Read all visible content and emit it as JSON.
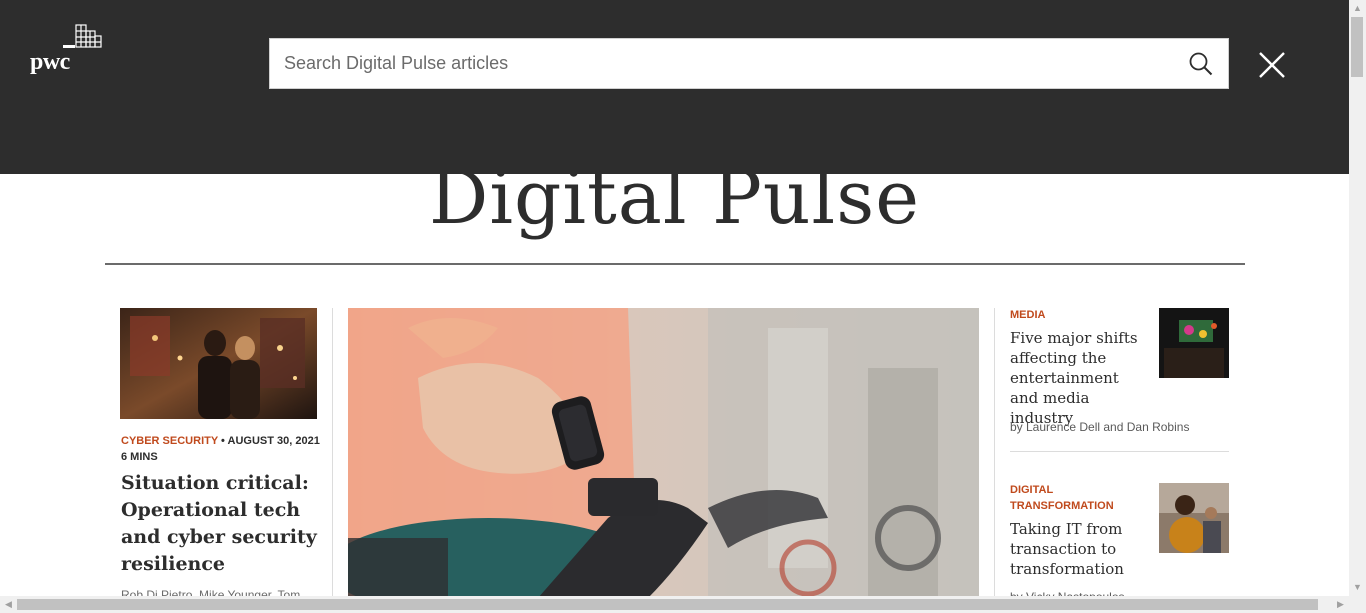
{
  "header": {
    "logo_text": "pwc",
    "search_placeholder": "Search Digital Pulse articles"
  },
  "page": {
    "title": "Digital Pulse"
  },
  "featured_left": {
    "category": "CYBER SECURITY",
    "date": "AUGUST 30, 2021",
    "read_time": "6 MINS",
    "headline": "Situation critical: Operational tech and cyber security resilience",
    "authors": "Rob Di Pietro, Mike Younger, Tom"
  },
  "right_articles": [
    {
      "category": "MEDIA",
      "headline": "Five major shifts affecting the entertainment and media industry",
      "authors": "by Laurence Dell and Dan Robins"
    },
    {
      "category": "DIGITAL TRANSFORMATION",
      "headline": "Taking IT from transaction to transformation",
      "authors": "by Vicky Nastopoulos"
    }
  ],
  "colors": {
    "header_bg": "#2d2d2d",
    "accent": "#c04a1d",
    "text": "#2d2d2d"
  },
  "icons": {
    "search": "search-icon",
    "close": "close-icon",
    "logo": "pwc-logo"
  }
}
